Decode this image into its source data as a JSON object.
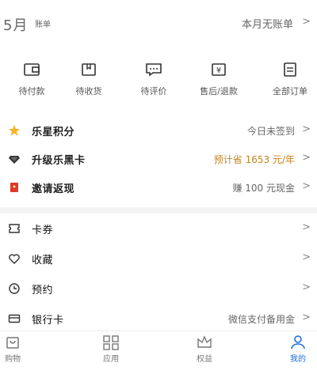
{
  "bill": {
    "month": "5月",
    "label": "账单",
    "status": "本月无账单"
  },
  "orders": [
    {
      "label": "待付款",
      "icon": "wallet-icon"
    },
    {
      "label": "待收货",
      "icon": "package-icon"
    },
    {
      "label": "待评价",
      "icon": "comment-icon"
    },
    {
      "label": "售后/退款",
      "icon": "refund-icon"
    },
    {
      "label": "全部订单",
      "icon": "order-list-icon"
    }
  ],
  "menu": [
    {
      "label": "乐星积分",
      "value": "今日未签到",
      "icon": "star-icon"
    },
    {
      "label": "升级乐黑卡",
      "value": "预计省 1653 元/年",
      "icon": "diamond-icon"
    },
    {
      "label": "邀请返现",
      "value": "赚 100 元现金",
      "icon": "red-envelope-icon"
    },
    {
      "label": "卡券",
      "value": "",
      "icon": "coupon-icon"
    },
    {
      "label": "收藏",
      "value": "",
      "icon": "heart-icon"
    },
    {
      "label": "预约",
      "value": "",
      "icon": "clock-icon"
    },
    {
      "label": "银行卡",
      "value": "微信支付备用金",
      "icon": "bank-card-icon"
    }
  ],
  "tabs": [
    {
      "label": "购物",
      "icon": "shopping-icon"
    },
    {
      "label": "应用",
      "icon": "apps-icon"
    },
    {
      "label": "权益",
      "icon": "crown-icon"
    },
    {
      "label": "我的",
      "icon": "person-icon",
      "active": true
    }
  ],
  "colors": {
    "accent": "#1c6fe0",
    "star": "#f5b22c",
    "highlight": "#c8821f",
    "envelope": "#e0382b"
  }
}
